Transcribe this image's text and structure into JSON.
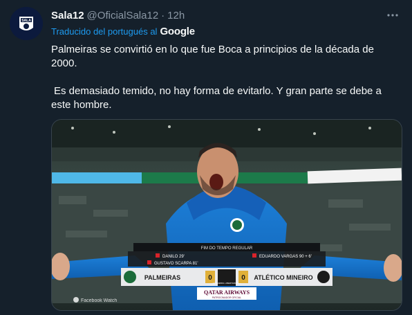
{
  "tweet": {
    "display_name": "Sala12",
    "handle": "@OficialSala12",
    "separator": "·",
    "time": "12h",
    "translated_label": "Traducido del portugués al",
    "translator": "Google",
    "text_line1": "Palmeiras se convirtió en lo que fue Boca a principios de la década de",
    "text_line2": "2000.",
    "text_line3": "Es demasiado temido, no hay forma de evitarlo. Y gran parte se debe a",
    "text_line4": "este hombre.",
    "avatar_text": "SALA"
  },
  "scoreboard": {
    "label": "FIM DO TEMPO REGULAR",
    "home_team": "PALMEIRAS",
    "away_team": "ATLÉTICO MINEIRO",
    "home_score": "0",
    "away_score": "0",
    "home_event1": "DANILO 29'",
    "home_event2": "GUSTAVO SCARPA 81'",
    "away_event1": "EDUARDO VARGAS 90 + 6'",
    "competition": "CONMEBOL LIBERTADORES",
    "sponsor": "QATAR AIRWAYS",
    "sponsor_sub": "PATROCINADOR OFICIAL",
    "watermark": "Facebook Watch"
  },
  "colors": {
    "background": "#15202b",
    "accent": "#1d9bf0",
    "muted": "#8b98a5"
  }
}
